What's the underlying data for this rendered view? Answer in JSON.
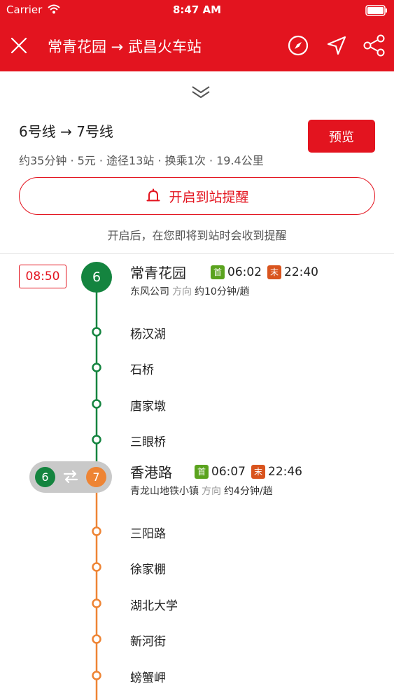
{
  "status_bar": {
    "carrier": "Carrier",
    "time": "8:47 AM"
  },
  "navbar": {
    "title": "常青花园 → 武昌火车站",
    "icons": [
      "close-icon",
      "compass-icon",
      "locate-icon",
      "share-icon"
    ]
  },
  "summary": {
    "lines": "6号线 → 7号线",
    "stats": "约35分钟 · 5元 · 途径13站 · 换乘1次 · 19.4公里",
    "preview_label": "预览"
  },
  "reminder": {
    "button_label": "开启到站提醒",
    "hint": "开启后，在您即将到站时会收到提醒"
  },
  "timeline": {
    "depart_time": "08:50",
    "first_tag": "首",
    "last_tag": "末",
    "direction_word": "方向",
    "legs": [
      {
        "line": "6",
        "color": "#14843f",
        "board_station": "常青花园",
        "first_train": "06:02",
        "last_train": "22:40",
        "direction": "东风公司",
        "frequency": "约10分钟/趟",
        "stops": [
          "杨汉湖",
          "石桥",
          "唐家墩",
          "三眼桥"
        ]
      },
      {
        "line": "7",
        "color": "#ee8434",
        "board_station": "香港路",
        "first_train": "06:07",
        "last_train": "22:46",
        "direction": "青龙山地铁小镇",
        "frequency": "约4分钟/趟",
        "stops": [
          "三阳路",
          "徐家棚",
          "湖北大学",
          "新河街",
          "螃蟹岬"
        ]
      }
    ],
    "transfer": {
      "from_line": "6",
      "to_line": "7"
    }
  },
  "colors": {
    "brand_red": "#e3141f",
    "line6_green": "#14843f",
    "line7_orange": "#ee8434"
  }
}
